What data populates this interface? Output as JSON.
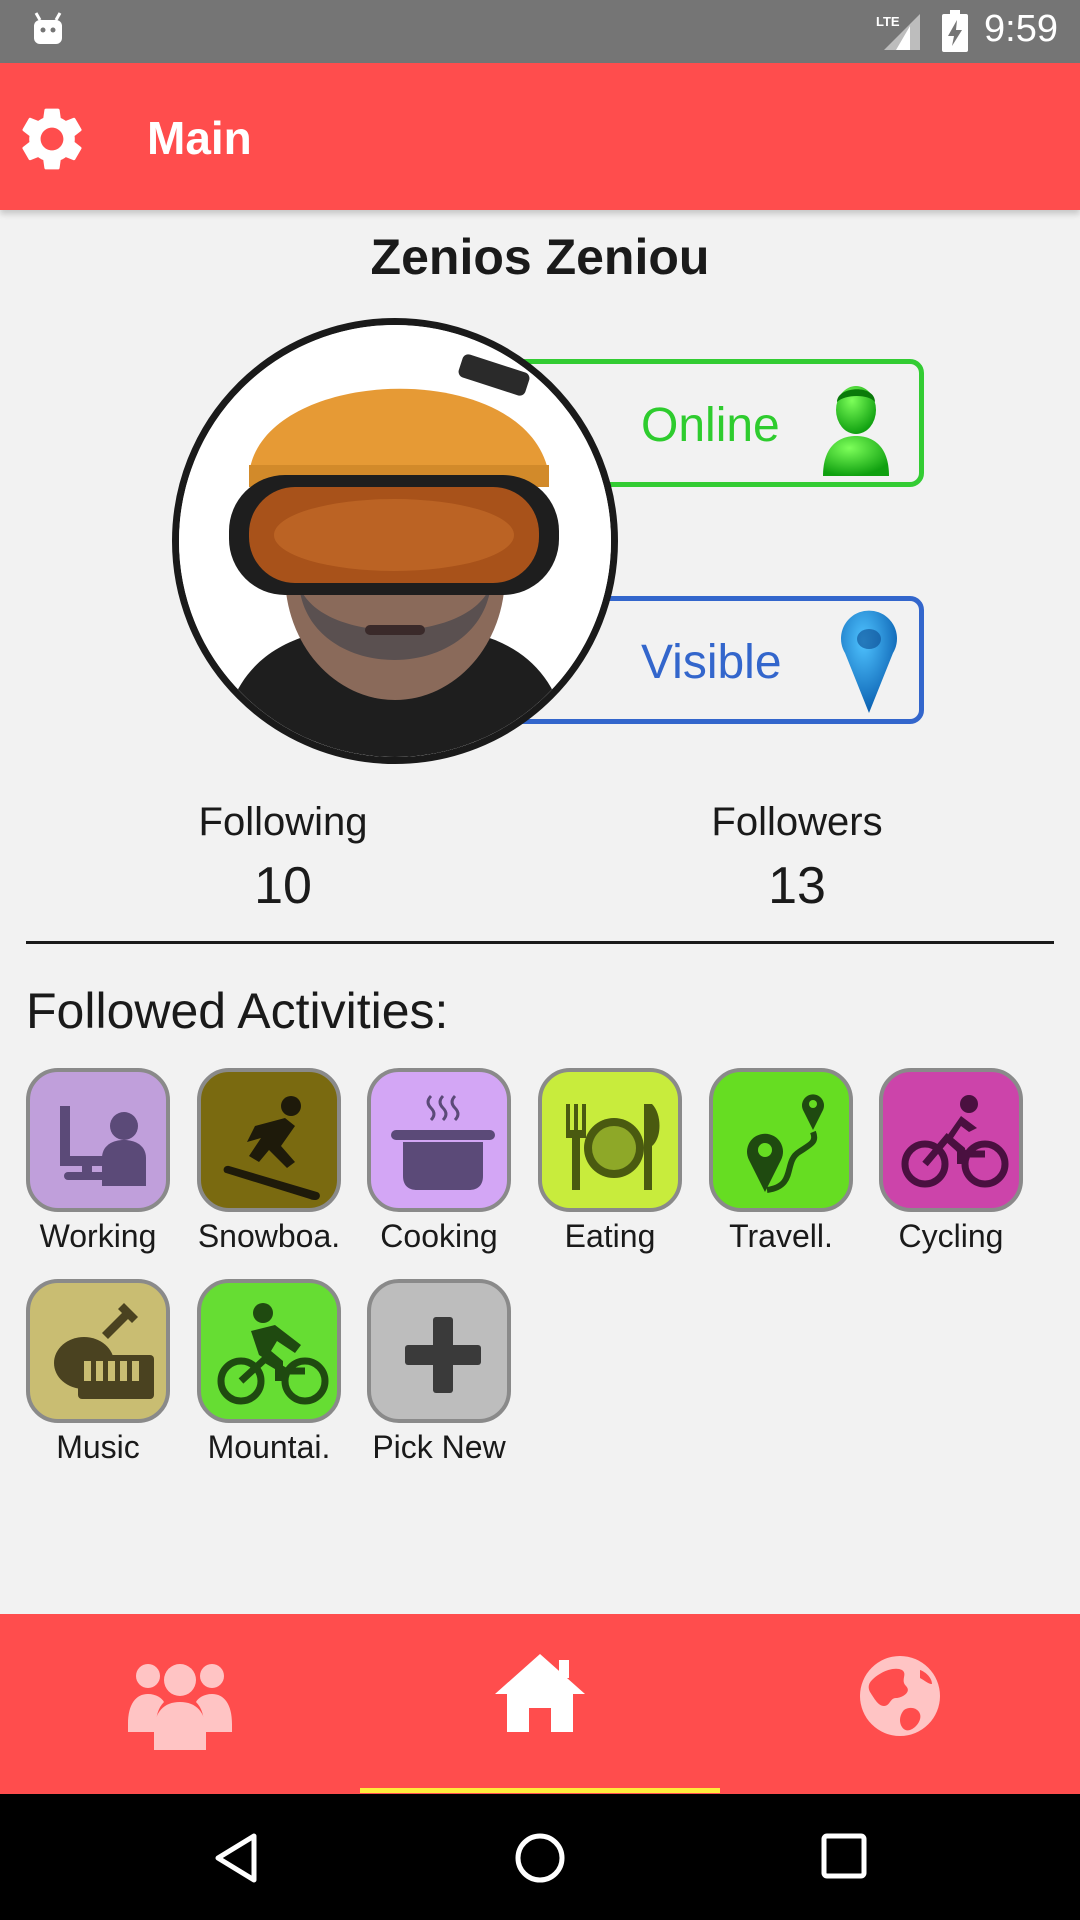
{
  "status_bar": {
    "time": "9:59",
    "network": "LTE"
  },
  "app_bar": {
    "title": "Main"
  },
  "profile": {
    "name": "Zenios Zeniou",
    "status_online": "Online",
    "status_visible": "Visible",
    "avatar_alt": "profile-photo"
  },
  "stats": {
    "following_label": "Following",
    "following_value": "10",
    "followers_label": "Followers",
    "followers_value": "13"
  },
  "activities": {
    "title": "Followed Activities:",
    "items": [
      {
        "label": "Working",
        "color": "#c09fdb",
        "icon": "working-icon"
      },
      {
        "label": "Snowboa.",
        "color": "#7a6a10",
        "icon": "snowboard-icon"
      },
      {
        "label": "Cooking",
        "color": "#d3a6f5",
        "icon": "cooking-pot-icon"
      },
      {
        "label": "Eating",
        "color": "#c8ec3c",
        "icon": "plate-cutlery-icon"
      },
      {
        "label": "Travell.",
        "color": "#66dd22",
        "icon": "route-pin-icon"
      },
      {
        "label": "Cycling",
        "color": "#cc44aa",
        "icon": "cyclist-icon"
      },
      {
        "label": "Music",
        "color": "#c9bd72",
        "icon": "guitar-keyboard-icon"
      },
      {
        "label": "Mountai.",
        "color": "#66dd33",
        "icon": "mountain-bike-icon"
      },
      {
        "label": "Pick New",
        "color": "#bdbdbd",
        "icon": "plus-icon"
      }
    ]
  },
  "bottom_nav": {
    "items": [
      "friends-icon",
      "home-icon",
      "globe-icon"
    ],
    "selected": "home"
  },
  "colors": {
    "primary": "#ff4d4d",
    "online": "#33cc33",
    "visible": "#3366cc",
    "indicator": "#ffeb3b"
  }
}
